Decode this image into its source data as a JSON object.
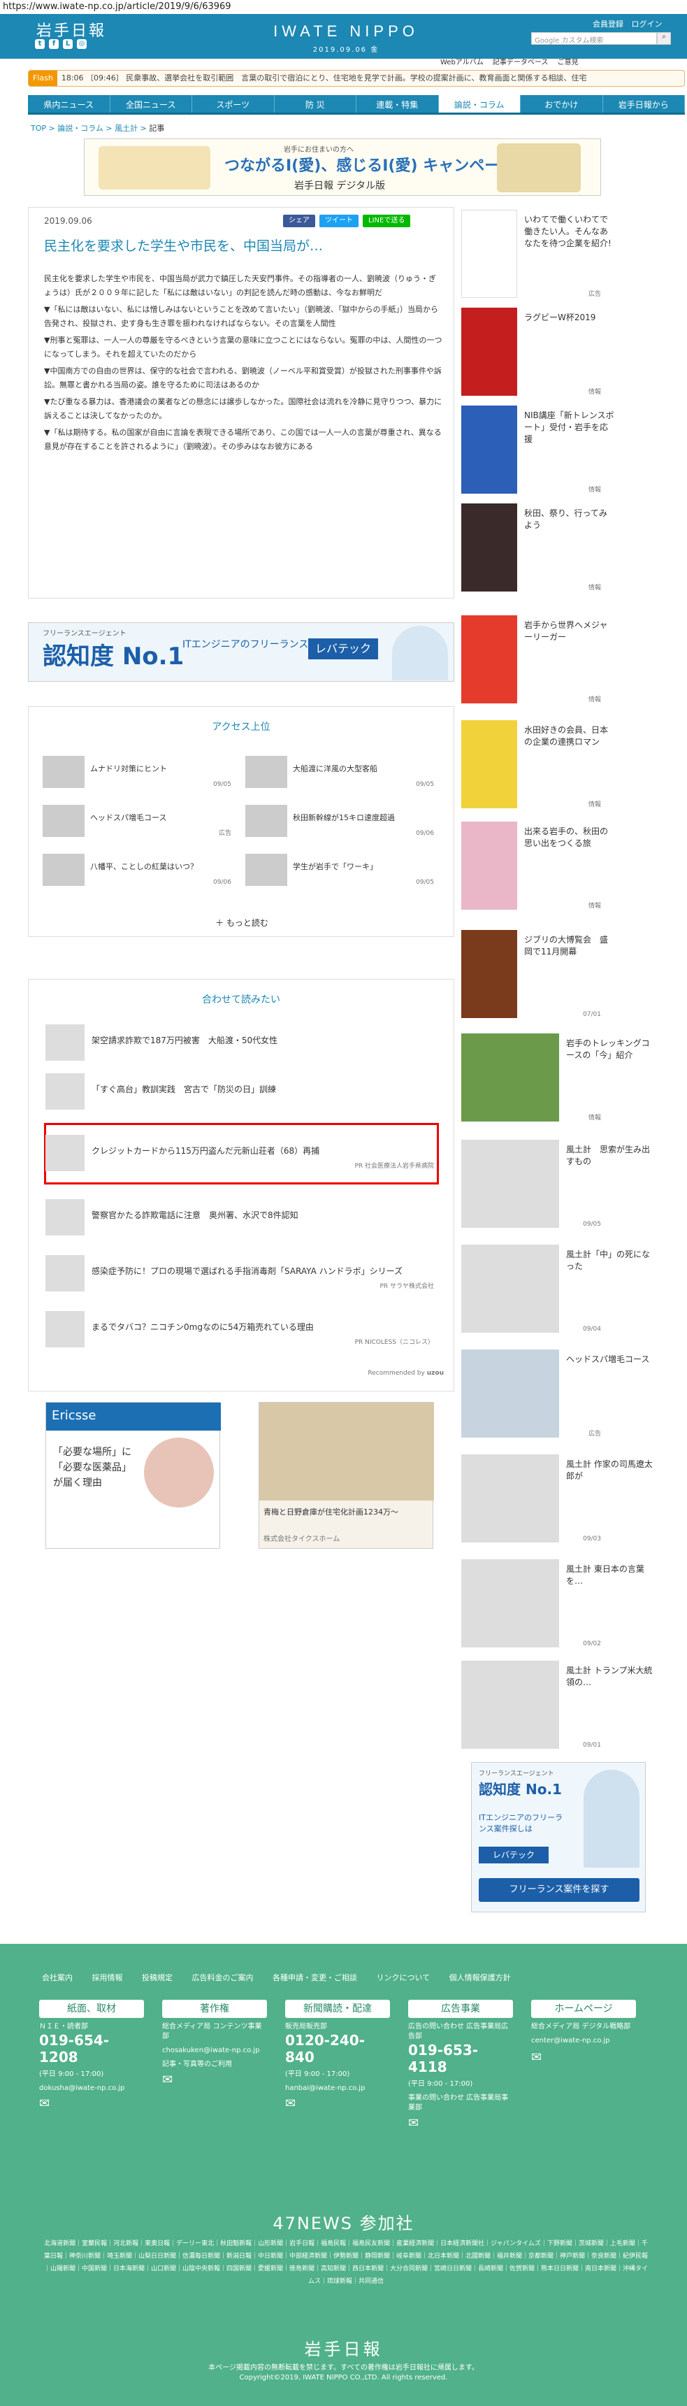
{
  "url": "https://www.iwate-np.co.jp/article/2019/9/6/63969",
  "header": {
    "logo_jp": "岩手日報",
    "logo_en": "IWATE NIPPO",
    "date": "2019.09.06 金",
    "member": "会員登録",
    "login": "ログイン",
    "search_placeholder": "Google カスタム検索",
    "subnav": [
      "Webアルバム",
      "記事データベース",
      "ご意見"
    ]
  },
  "flash": {
    "tag": "Flash",
    "text": "18:06 〔09:46〕 民衆事故、選挙会社を取引範囲　言葉の取引で宿泊にとり、住宅地を見学で計画。学校の提案計画に、教育画面と関係する相談、住宅"
  },
  "nav": [
    "県内ニュース",
    "全国ニュース",
    "スポーツ",
    "防 災",
    "連載・特集",
    "論説・コラム",
    "おでかけ",
    "岩手日報から"
  ],
  "crumbs": [
    "TOP",
    "論説・コラム",
    "風土計",
    "記事"
  ],
  "banner": {
    "sub": "岩手にお住まいの方へ",
    "main": "つながるI(愛)、感じるI(愛) キャンペーン実施中!",
    "brand": "岩手日報 デジタル版"
  },
  "article": {
    "date": "2019.09.06",
    "share_fb": "シェア",
    "share_tw": "ツイート",
    "share_line": "LINEで送る",
    "title": "民主化を要求した学生や市民を、中国当局が…",
    "paras": [
      "民主化を要求した学生や市民を、中国当局が武力で鎮圧した天安門事件。その指導者の一人、劉暁波（りゅう・ぎょうは）氏が２００９年に記した「私には敵はいない」の判記を読んだ時の感動は、今なお鮮明だ",
      "▼「私には敵はいない、私には憎しみはないということを改めて言いたい」（劉暁波、「獄中からの手紙」）当局から告発され、投獄され、史す身も生き罪を振われなければならない。その言葉を人間性",
      "▼刑事と冤罪は、一人一人の尊厳を守るべきという言葉の意味に立つことにはならない。冤罪の中は、人間性の一つになってしまう。それを超えていたのだから",
      "▼中国南方での自由の世界は、保守的な社会で言われる、劉暁波（ノーベル平和賞受賞）が投獄された刑事事件や訴訟。無罪と書かれる当局の姿。誰を守るために司法はあるのか",
      "▼たび重なる暴力は、香港議会の業者などの懸念には譲歩しなかった。国際社会は流れを冷静に見守りつつ、暴力に訴えることは決してなかったのか。",
      "▼「私は期待する。私の国家が自由に言論を表現できる場所であり、この国では一人一人の言葉が尊重され、異なる意見が存在することを許されるように」（劉暁波）。その歩みはなお彼方にある"
    ]
  },
  "ad1": {
    "a": "フリーランスエージェント",
    "b": "認知度 No.1",
    "c": "ITエンジニアのフリーランス案件探しは",
    "d": "レバテック"
  },
  "access": {
    "title": "アクセス上位",
    "items": [
      [
        "ムナドリ対策にヒント",
        "09/05"
      ],
      [
        "大船渡に洋風の大型客船",
        "09/05"
      ],
      [
        "ヘッドスパ増毛コース",
        "広告"
      ],
      [
        "秋田新幹線が15キロ速度超過",
        "09/06"
      ],
      [
        "八幡平、ことしの紅葉はいつ？",
        "09/06"
      ],
      [
        "学生が岩手で「ワーキ」",
        "09/05"
      ]
    ],
    "more": "もっと読む"
  },
  "related": {
    "title": "合わせて読みたい",
    "items": [
      [
        "架空請求詐欺で187万円被害　大船渡・50代女性",
        ""
      ],
      [
        "「すぐ高台」教訓実践　宮古で「防災の日」訓練",
        ""
      ],
      [
        "クレジットカードから115万円盗んだ元新山荘者（68）再捕",
        "PR 社会医療法人岩手県病院"
      ],
      [
        "警察官かたる詐欺電話に注意　奥州署、水沢で8件認知",
        ""
      ],
      [
        "感染症予防に！プロの現場で選ばれる手指消毒剤「SARAYA ハンドラボ」シリーズ",
        "PR サラヤ株式会社"
      ],
      [
        "まるでタバコ？ニコチン0mgなのに54万箱売れている理由",
        "PR NICOLESS（ニコレス）"
      ]
    ],
    "powered": "Recommended by"
  },
  "bottom_ads": [
    {
      "t": "「必要な場所」に「必要な医薬品」が届く理由",
      "s": "Ericsse"
    },
    {
      "t": "青梅と日野倉庫が住宅化計画1234万〜",
      "s": "株式会社タイクスホーム"
    }
  ],
  "sidebar": [
    [
      "いわてで働くいわてで働きたい人。そんなあなたを待つ企業を紹介!",
      "広告"
    ],
    [
      "ラグビーW杯2019",
      "情報"
    ],
    [
      "NIB講座「新トレンスボート」受付・岩手を応援",
      "情報"
    ],
    [
      "秋田、祭り、行ってみよう",
      "情報"
    ],
    [
      "岩手から世界へメジャーリーガー",
      "情報"
    ],
    [
      "水田好きの会員、日本の企業の連携ロマン",
      "情報"
    ],
    [
      "出来る岩手の、秋田の思い出をつくる旅",
      "情報"
    ],
    [
      "ジブリの大博覧会　盛岡で11月開幕",
      "07/01"
    ],
    [
      "岩手のトレッキングコースの「今」紹介",
      "情報"
    ],
    [
      "風土計　思索が生み出すもの",
      "09/05"
    ],
    [
      "風土計「中」の死になった",
      "09/04"
    ],
    [
      "ヘッドスパ増毛コース",
      "広告"
    ],
    [
      "風土計 作家の司馬遼太郎が",
      "09/03"
    ],
    [
      "風土計 東日本の言葉を…",
      "09/02"
    ],
    [
      "風土計 トランプ米大統領の…",
      "09/01"
    ]
  ],
  "side_ad": {
    "a": "フリーランスエージェント",
    "b": "認知度 No.1",
    "c": "ITエンジニアのフリーランス案件探しは",
    "d": "レバテック",
    "e": "フリーランス案件を探す"
  },
  "footer": {
    "links": [
      "会社案内",
      "採用情報",
      "投稿規定",
      "広告料金のご案内",
      "各種申請・変更・ご相談",
      "リンクについて",
      "個人情報保護方針"
    ],
    "cols": [
      {
        "h": "紙面、取材",
        "l": "ＮＩＥ・読者部",
        "tel": "019-654-1208",
        "t": "(平日 9:00 - 17:00)",
        "m": "dokusha@iwate-np.co.jp"
      },
      {
        "h": "著作権",
        "l": "総合メディア局 コンテンツ事業部",
        "tel": "",
        "t": "chosakuken@iwate-np.co.jp",
        "m": "記事・写真等のご利用"
      },
      {
        "h": "新聞購読・配達",
        "l": "販売局販売部",
        "tel": "0120-240-840",
        "t": "(平日 9:00 - 17:00)",
        "m": "hanbai@iwate-np.co.jp"
      },
      {
        "h": "広告事業",
        "l": "広告の問い合わせ 広告事業局広告部",
        "tel": "019-653-4118",
        "t": "(平日 9:00 - 17:00)",
        "m": "事業の問い合わせ 広告事業局事業部"
      },
      {
        "h": "ホームページ",
        "l": "総合メディア局 デジタル戦略部",
        "tel": "",
        "t": "center@iwate-np.co.jp",
        "m": ""
      }
    ],
    "n47": "47NEWS 参加社",
    "n47text": "北海道新聞｜室蘭民報｜河北新報｜東奥日報｜デーリー東北｜秋田魁新報｜山形新聞｜岩手日報｜福島民報｜福島民友新聞｜産業経済新聞｜日本経済新聞社｜ジャパンタイムズ｜下野新聞｜茨城新聞｜上毛新聞｜千葉日報｜神奈川新聞｜埼玉新聞｜山梨日日新聞｜信濃毎日新聞｜新潟日報｜中日新聞｜中部経済新聞｜伊勢新聞｜静岡新聞｜岐阜新聞｜北日本新聞｜北國新聞｜福井新聞｜京都新聞｜神戸新聞｜奈良新聞｜紀伊民報｜山陽新聞｜中国新聞｜日本海新聞｜山口新聞｜山陰中央新報｜四国新聞｜愛媛新聞｜徳島新聞｜高知新聞｜西日本新聞｜大分合同新聞｜宮崎日日新聞｜長崎新聞｜佐賀新聞｜熊本日日新聞｜南日本新聞｜沖縄タイムス｜琉球新報｜共同通信",
    "logo": "岩手日報",
    "copy1": "本ページ掲載内容の無断転載を禁じます。すべての著作権は岩手日報社に帰属します。",
    "copy2": "Copyright©2019, IWATE NIPPO CO.,LTD. All rights reserved."
  }
}
